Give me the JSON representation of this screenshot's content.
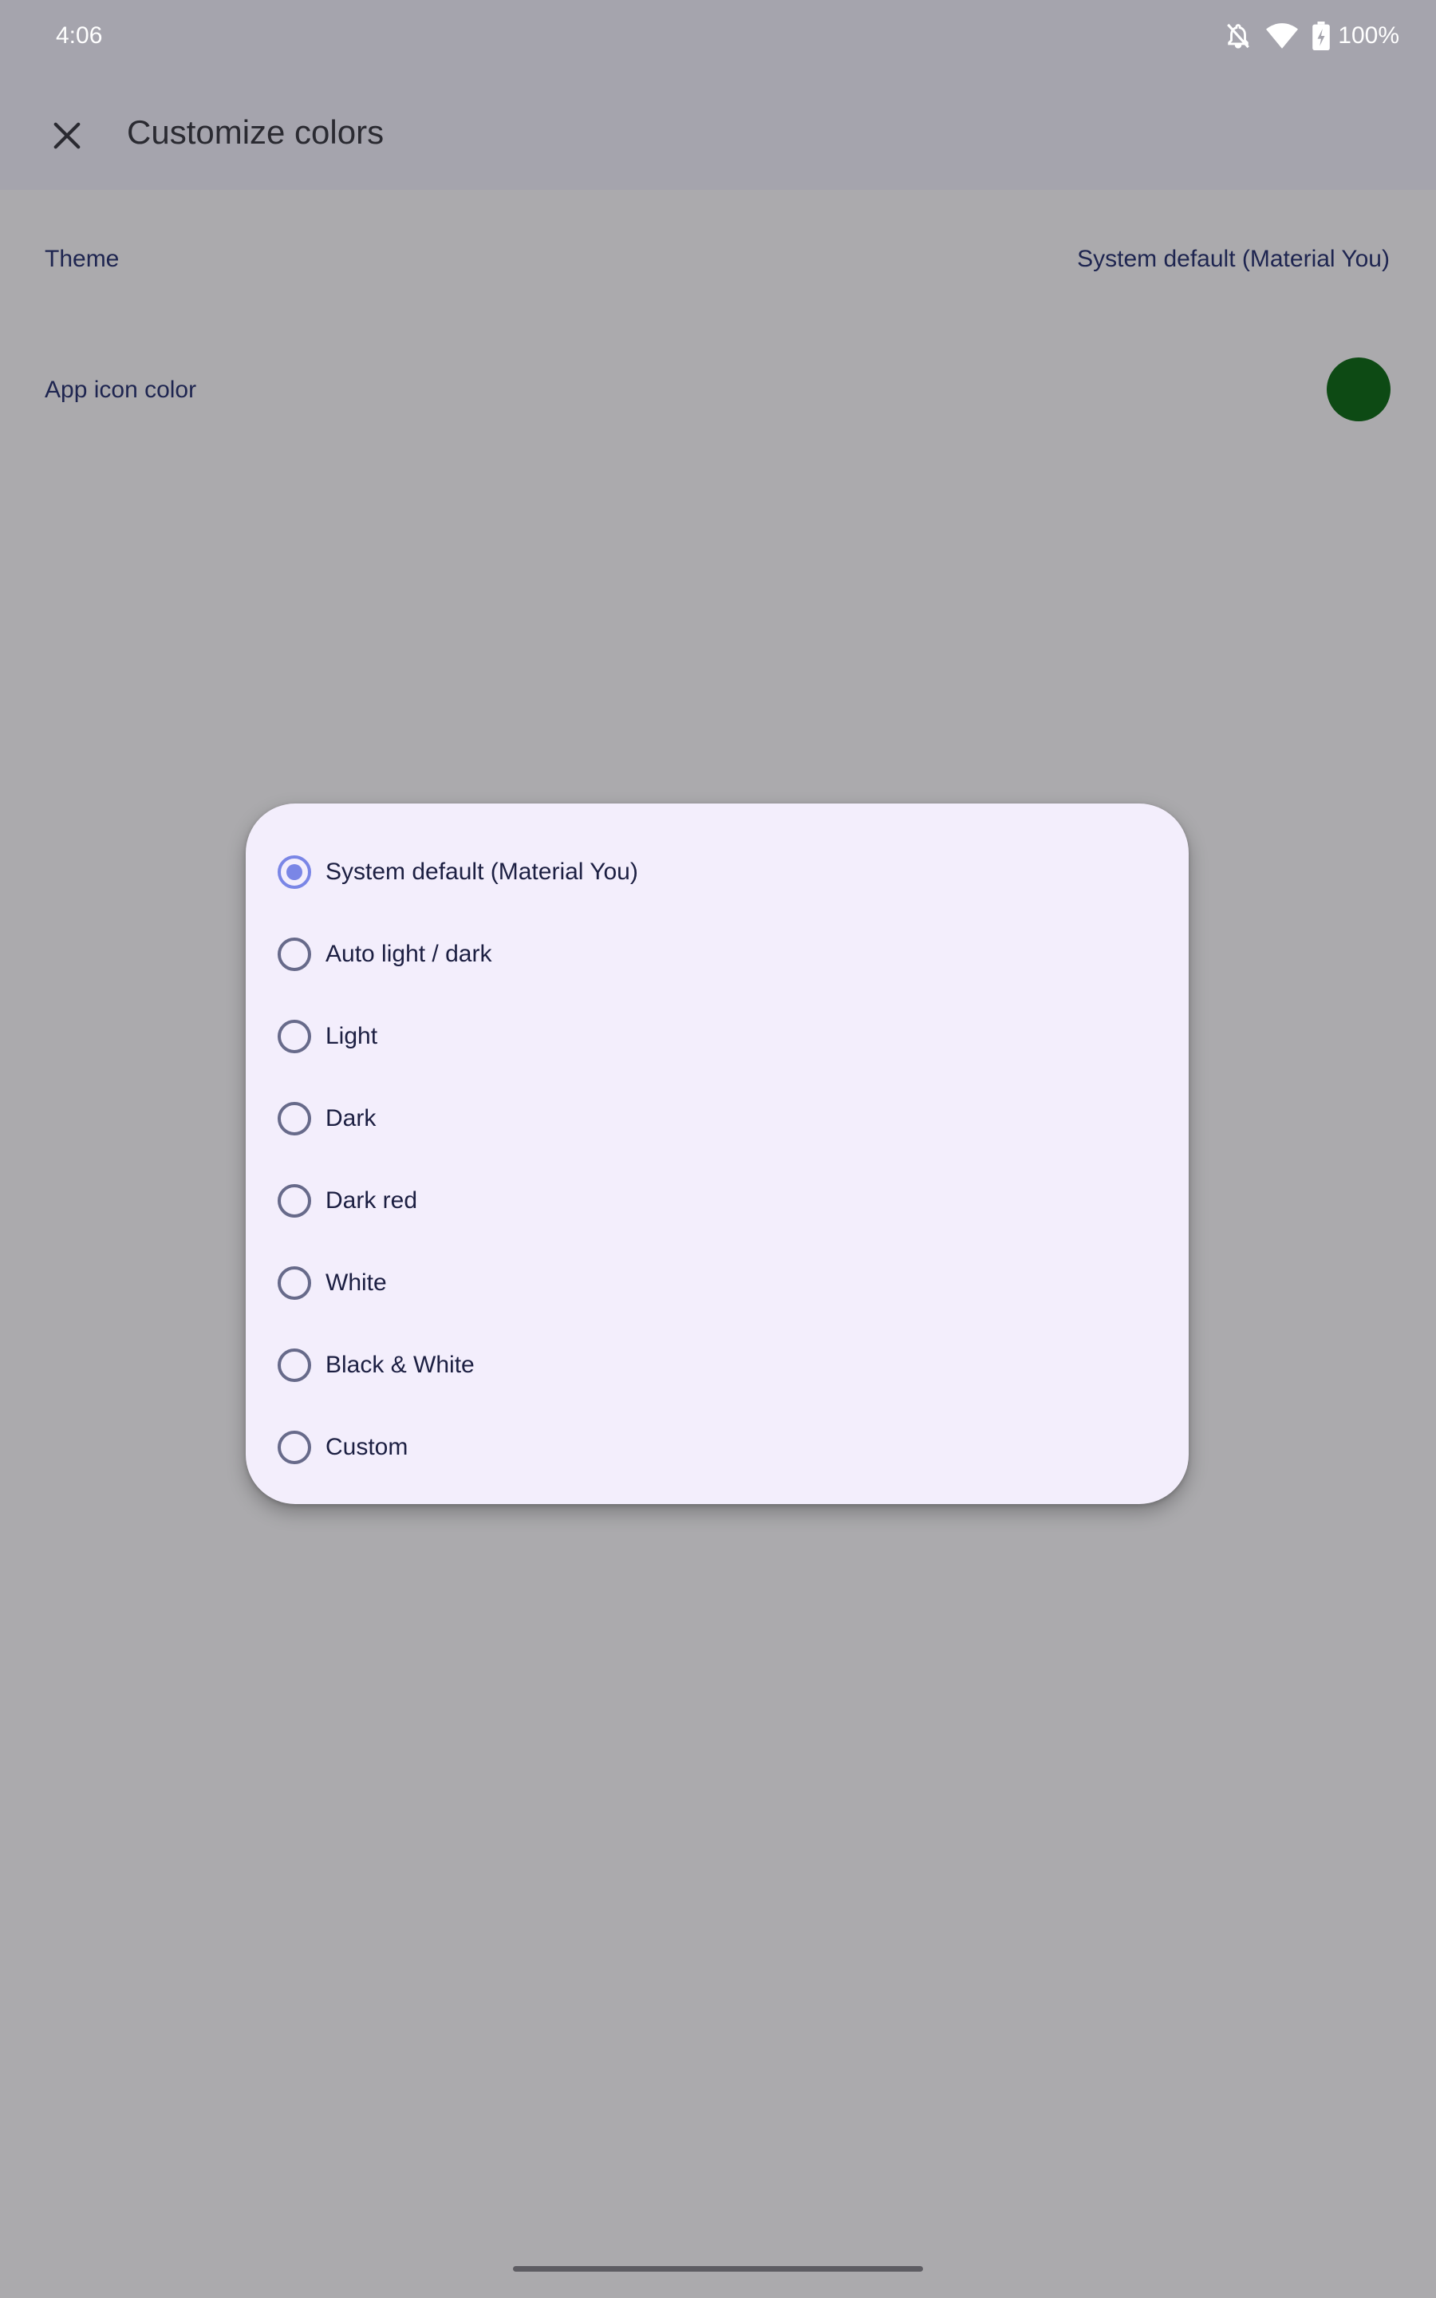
{
  "status_bar": {
    "time": "4:06",
    "battery": "100%",
    "icons": [
      "notifications-off-icon",
      "wifi-icon",
      "battery-charging-icon"
    ]
  },
  "app_bar": {
    "title": "Customize colors",
    "close_icon": "close-icon"
  },
  "settings": {
    "theme_label": "Theme",
    "theme_value": "System default (Material You)",
    "app_icon_color_label": "App icon color",
    "app_icon_color": "#0d4a14"
  },
  "dialog": {
    "options": [
      {
        "label": "System default (Material You)",
        "selected": true
      },
      {
        "label": "Auto light / dark",
        "selected": false
      },
      {
        "label": "Light",
        "selected": false
      },
      {
        "label": "Dark",
        "selected": false
      },
      {
        "label": "Dark red",
        "selected": false
      },
      {
        "label": "White",
        "selected": false
      },
      {
        "label": "Black & White",
        "selected": false
      },
      {
        "label": "Custom",
        "selected": false
      }
    ]
  },
  "colors": {
    "scrim": "#abaaad",
    "dialog_bg": "#f3eefc",
    "accent": "#7a86e6"
  }
}
